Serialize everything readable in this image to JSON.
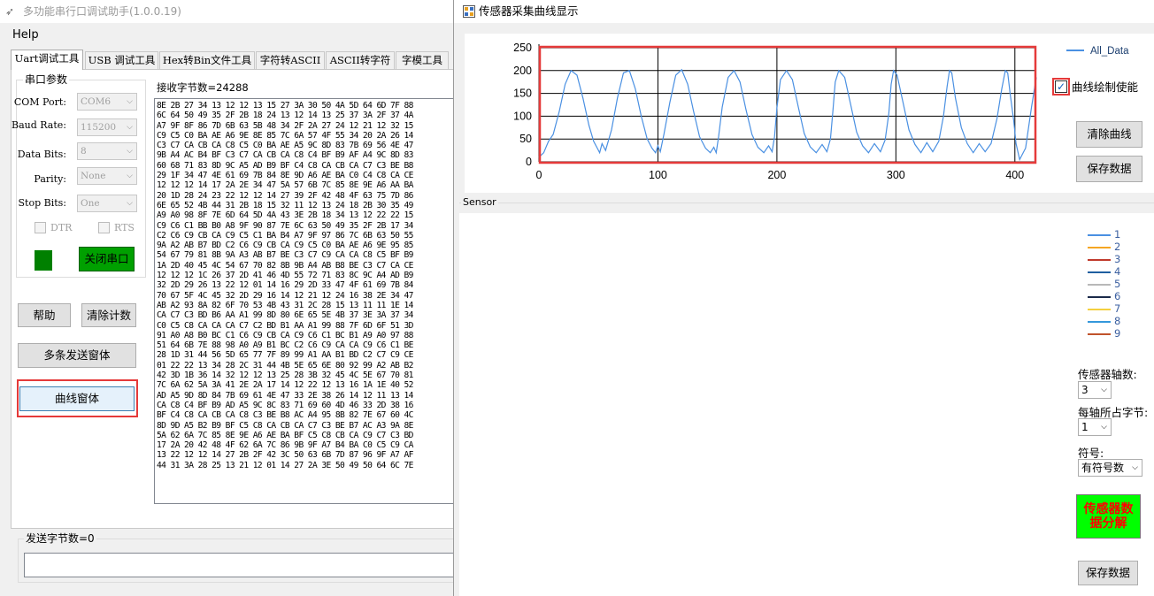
{
  "main_window": {
    "title": "多功能串行口调试助手(1.0.0.19)",
    "menu": "Help",
    "tabs": [
      "Uart调试工具",
      "USB 调试工具",
      "Hex转Bin文件工具",
      "字符转ASCII",
      "ASCII转字符",
      "字模工具"
    ],
    "serial_group": {
      "title": "串口参数",
      "com_port": {
        "label": "COM Port:",
        "value": "COM6"
      },
      "baud_rate": {
        "label": "Baud Rate:",
        "value": "115200"
      },
      "data_bits": {
        "label": "Data Bits:",
        "value": "8"
      },
      "parity": {
        "label": "Parity:",
        "value": "None"
      },
      "stop_bits": {
        "label": "Stop Bits:",
        "value": "One"
      },
      "dtr": "DTR",
      "rts": "RTS",
      "close_button": "关闭串口",
      "status_color": "#008000"
    },
    "buttons": {
      "help": "帮助",
      "clear_count": "清除计数",
      "multi_send": "多条发送窗体",
      "curve_window": "曲线窗体"
    },
    "receive_label": "接收字节数=24288",
    "send_label": "发送字节数=0",
    "hex_lines": [
      "8E 2B 27 34 13 12 12 13 15 27 3A 30 50 4A 5D 64 6D 7F 88",
      "6C 64 50 49 35 2F 2B 18 24 13 12 14 13 25 37 3A 2F 37 4A",
      "A7 9F 8F 86 7D 6B 63 5B 48 34 2F 2A 27 24 12 21 12 32 15",
      "C9 C5 C0 BA AE A6 9E 8E 85 7C 6A 57 4F 55 34 20 2A 26 14",
      "C3 C7 CA CB CA C8 C5 C0 BA AE A5 9C 8D 83 7B 69 56 4E 47",
      "9B A4 AC B4 BF C3 C7 CA CB CA C8 C4 BF B9 AF A4 9C 8D 83",
      "60 68 71 83 8D 9C A5 AD B9 BF C4 C8 CA CB CA C7 C3 BE B8",
      "29 1F 34 47 4E 61 69 7B 84 8E 9D A6 AE BA C0 C4 C8 CA CE",
      "12 12 12 14 17 2A 2E 34 47 5A 57 6B 7C 85 8E 9E A6 AA BA",
      "20 1D 28 24 23 22 12 12 14 27 39 2F 42 48 4F 63 75 7D 86",
      "6E 65 52 4B 44 31 2B 18 15 32 11 12 13 24 18 2B 30 35 49",
      "A9 A0 98 8F 7E 6D 64 5D 4A 43 3E 2B 18 34 13 12 22 22 15",
      "C9 C6 C1 BB B0 A8 9F 90 87 7E 6C 63 50 49 35 2F 2B 17 34",
      "C2 C6 C9 CB CA C9 C5 C1 BA B4 A7 9F 97 86 7C 6B 63 50 55",
      "9A A2 AB B7 BD C2 C6 C9 CB CA C9 C5 C0 BA AE A6 9E 95 85",
      "54 67 79 81 8B 9A A3 AB B7 BE C3 C7 C9 CA CA C8 C5 BF B9",
      "1A 2D 40 45 4C 54 67 70 82 8B 9B A4 AB B8 BE C3 C7 CA CE",
      "12 12 12 1C 26 37 2D 41 46 4D 55 72 71 83 8C 9C A4 AD B9",
      "32 2D 29 26 13 22 12 01 14 16 29 2D 33 47 4F 61 69 7B 84",
      "70 67 5F 4C 45 32 2D 29 16 14 12 21 12 24 16 38 2E 34 47",
      "AB A2 93 8A 82 6F 70 53 4B 43 31 2C 28 15 13 11 11 1E 14",
      "CA C7 C3 BD B6 AA A1 99 8D 80 6E 65 5E 4B 37 3E 3A 37 34",
      "C0 C5 C8 CA CA CA C7 C2 BD B1 AA A1 99 88 7F 6D 6F 51 3D",
      "91 A0 A8 B0 BC C1 C6 C9 CB CA C9 C6 C1 BC B1 A9 A0 97 88",
      "51 64 6B 7E 88 98 A0 A9 B1 BC C2 C6 C9 CA CA C9 C6 C1 BE",
      "28 1D 31 44 56 5D 65 77 7F 89 99 A1 AA B1 BD C2 C7 C9 CE",
      "01 22 22 13 34 28 2C 31 44 4B 5E 65 6E 80 92 99 A2 AB B2",
      "42 3D 1B 36 14 32 12 12 13 25 28 3B 32 45 4C 5E 67 70 81",
      "7C 6A 62 5A 3A 41 2E 2A 17 14 12 22 12 13 16 1A 1E 40 52",
      "AD A5 9D 8D 84 7B 69 61 4E 47 33 2E 38 26 14 12 11 13 14",
      "CA C8 C4 BF B9 AD A5 9C 8C 83 71 69 60 4D 46 33 2D 38 16",
      "BF C4 C8 CA CB CA C8 C3 BE B8 AC A4 95 8B 82 7E 67 60 4C",
      "8D 9D A5 B2 B9 BF C5 C8 CA CB CA C7 C3 BE B7 AC A3 9A 8E",
      "5A 62 6A 7C 85 8E 9E A6 AE BA BF C5 C8 CB CA C9 C7 C3 BD",
      "17 2A 20 42 48 4F 62 6A 7C 86 9B 9F A7 B4 BA C0 C5 C9 CA",
      "13 22 12 12 14 27 2B 2F 42 3C 50 63 6B 7D 87 96 9F A7 AF",
      "44 31 3A 28 25 13 21 12 01 14 27 2A 3E 50 49 50 64 6C 7E"
    ]
  },
  "chart_window": {
    "title": "传感器采集曲线显示",
    "enable_checkbox": {
      "label": "曲线绘制使能",
      "checked": true
    },
    "clear_button": "清除曲线",
    "save_button": "保存数据",
    "sensor_group": "Sensor",
    "sensor_legend": [
      {
        "name": "1",
        "color": "#4a90e2"
      },
      {
        "name": "2",
        "color": "#f5a623"
      },
      {
        "name": "3",
        "color": "#c0392b"
      },
      {
        "name": "4",
        "color": "#1f5fa0"
      },
      {
        "name": "5",
        "color": "#b8b8b8"
      },
      {
        "name": "6",
        "color": "#1b2a4a"
      },
      {
        "name": "7",
        "color": "#f4d03f"
      },
      {
        "name": "8",
        "color": "#3498db"
      },
      {
        "name": "9",
        "color": "#c0532b"
      }
    ],
    "axis_count": {
      "label": "传感器轴数:",
      "value": "3"
    },
    "bytes_per_axis": {
      "label": "每轴所占字节:",
      "value": "1"
    },
    "sign": {
      "label": "符号:",
      "value": "有符号数"
    },
    "parse_button": "传感器数据分解",
    "save_button_2": "保存数据",
    "parse_button_color": "#00ff00",
    "parse_text_color": "#ff0000"
  },
  "chart_data": {
    "type": "line",
    "title": "",
    "xlabel": "",
    "ylabel": "",
    "xlim": [
      0,
      418
    ],
    "ylim": [
      0,
      250
    ],
    "x_ticks": [
      0,
      100,
      200,
      300,
      400
    ],
    "y_ticks": [
      0,
      50,
      100,
      150,
      200,
      250
    ],
    "grid": true,
    "legend": "top-right",
    "series": [
      {
        "name": "All_Data",
        "color": "#4a90e2",
        "period": 49,
        "x": [
          0,
          4,
          8,
          12,
          17,
          22,
          27,
          32,
          37,
          42,
          46,
          49,
          51,
          53,
          56,
          61,
          66,
          71,
          76,
          81,
          86,
          91,
          95,
          98,
          100,
          102,
          105,
          110,
          115,
          120,
          125,
          130,
          135,
          140,
          144,
          147,
          149,
          151,
          154,
          159,
          164,
          169,
          174,
          179,
          184,
          189,
          193,
          196,
          198,
          200,
          203,
          208,
          213,
          218,
          223,
          228,
          233,
          238,
          242,
          245,
          247,
          249,
          252,
          257,
          262,
          267,
          272,
          277,
          282,
          287,
          291,
          294,
          296,
          298,
          301,
          306,
          311,
          316,
          321,
          326,
          331,
          336,
          340,
          343,
          345,
          347,
          350,
          355,
          360,
          365,
          370,
          375,
          380,
          385,
          389,
          392,
          394,
          396,
          399,
          401,
          404,
          409,
          414,
          418
        ],
        "y": [
          10,
          20,
          45,
          60,
          110,
          170,
          200,
          190,
          140,
          80,
          45,
          30,
          20,
          40,
          25,
          70,
          140,
          195,
          200,
          160,
          100,
          50,
          30,
          20,
          35,
          22,
          60,
          130,
          190,
          202,
          170,
          110,
          55,
          30,
          20,
          32,
          20,
          55,
          120,
          185,
          200,
          175,
          115,
          60,
          32,
          20,
          35,
          22,
          55,
          118,
          180,
          200,
          180,
          120,
          62,
          33,
          20,
          38,
          22,
          50,
          110,
          175,
          200,
          185,
          125,
          65,
          35,
          20,
          40,
          22,
          48,
          105,
          170,
          200,
          190,
          130,
          70,
          38,
          20,
          42,
          22,
          45,
          100,
          165,
          200,
          195,
          140,
          75,
          40,
          20,
          40,
          22,
          40,
          95,
          160,
          200,
          195,
          150,
          90,
          40,
          5,
          30,
          120,
          185
        ]
      }
    ]
  }
}
